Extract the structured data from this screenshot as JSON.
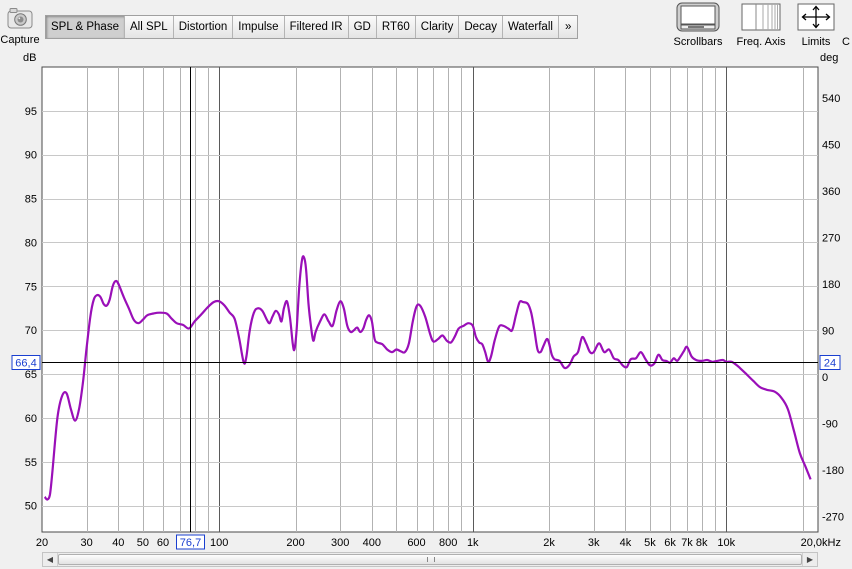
{
  "toolbar": {
    "capture_label": "Capture",
    "tabs": [
      "SPL & Phase",
      "All SPL",
      "Distortion",
      "Impulse",
      "Filtered IR",
      "GD",
      "RT60",
      "Clarity",
      "Decay",
      "Waterfall"
    ],
    "more_label": "»",
    "scrollbars_label": "Scrollbars",
    "freq_axis_label": "Freq. Axis",
    "limits_label": "Limits",
    "cut_label": "C"
  },
  "axes": {
    "left_unit": "dB",
    "right_unit": "deg",
    "x_unit": "kHz"
  },
  "chart_data": {
    "type": "line",
    "x_scale": "log",
    "xlim": [
      20,
      23000
    ],
    "ylim": [
      47,
      100
    ],
    "y2lim": [
      -300,
      600
    ],
    "xticks": [
      {
        "v": 20,
        "label": "20"
      },
      {
        "v": 30,
        "label": "30"
      },
      {
        "v": 40,
        "label": "40"
      },
      {
        "v": 50,
        "label": "50"
      },
      {
        "v": 60,
        "label": "60"
      },
      {
        "v": 100,
        "label": "100"
      },
      {
        "v": 200,
        "label": "200"
      },
      {
        "v": 300,
        "label": "300"
      },
      {
        "v": 400,
        "label": "400"
      },
      {
        "v": 600,
        "label": "600"
      },
      {
        "v": 800,
        "label": "800"
      },
      {
        "v": 1000,
        "label": "1k"
      },
      {
        "v": 2000,
        "label": "2k"
      },
      {
        "v": 3000,
        "label": "3k"
      },
      {
        "v": 4000,
        "label": "4k"
      },
      {
        "v": 5000,
        "label": "5k"
      },
      {
        "v": 6000,
        "label": "6k"
      },
      {
        "v": 7000,
        "label": "7k"
      },
      {
        "v": 8000,
        "label": "8k"
      },
      {
        "v": 10000,
        "label": "10k"
      },
      {
        "v": 20000,
        "label": "20,0kHz"
      }
    ],
    "yticks": [
      50,
      55,
      60,
      65,
      70,
      75,
      80,
      85,
      90,
      95
    ],
    "y2ticks": [
      -270,
      -180,
      -90,
      0,
      90,
      180,
      270,
      360,
      450,
      540
    ],
    "cursor": {
      "x": 76.7,
      "x_label": "76,7",
      "y": 66.4,
      "y_label": "66,4",
      "y2_label": "24"
    },
    "series": [
      {
        "color": "#9a0fb8",
        "points": [
          [
            20.5,
            51
          ],
          [
            21,
            50.7
          ],
          [
            21.5,
            51.3
          ],
          [
            22,
            54
          ],
          [
            23,
            60
          ],
          [
            24,
            62.5
          ],
          [
            25,
            62.8
          ],
          [
            26,
            61
          ],
          [
            27,
            59.7
          ],
          [
            28,
            61
          ],
          [
            29,
            64
          ],
          [
            30,
            68
          ],
          [
            31,
            71.5
          ],
          [
            32,
            73.5
          ],
          [
            33,
            74
          ],
          [
            34,
            73.8
          ],
          [
            35,
            73
          ],
          [
            36,
            72.8
          ],
          [
            37,
            73.5
          ],
          [
            38,
            75
          ],
          [
            39,
            75.6
          ],
          [
            40,
            75.3
          ],
          [
            42,
            73.8
          ],
          [
            44,
            72.5
          ],
          [
            46,
            71.2
          ],
          [
            48,
            70.8
          ],
          [
            50,
            71.2
          ],
          [
            52,
            71.7
          ],
          [
            55,
            71.9
          ],
          [
            58,
            72
          ],
          [
            62,
            71.9
          ],
          [
            65,
            71.3
          ],
          [
            68,
            70.8
          ],
          [
            72,
            70.6
          ],
          [
            76,
            70.2
          ],
          [
            80,
            71
          ],
          [
            85,
            71.8
          ],
          [
            90,
            72.6
          ],
          [
            95,
            73.2
          ],
          [
            100,
            73.3
          ],
          [
            105,
            72.8
          ],
          [
            110,
            72
          ],
          [
            115,
            71.3
          ],
          [
            120,
            69
          ],
          [
            125,
            66.3
          ],
          [
            128,
            67
          ],
          [
            132,
            70
          ],
          [
            137,
            72
          ],
          [
            142,
            72.5
          ],
          [
            148,
            72.2
          ],
          [
            154,
            71.2
          ],
          [
            158,
            70.8
          ],
          [
            162,
            71.5
          ],
          [
            167,
            72.2
          ],
          [
            172,
            71.8
          ],
          [
            176,
            71
          ],
          [
            180,
            72.5
          ],
          [
            185,
            73.3
          ],
          [
            190,
            71.5
          ],
          [
            195,
            68.5
          ],
          [
            198,
            67.8
          ],
          [
            202,
            70
          ],
          [
            207,
            75
          ],
          [
            212,
            78
          ],
          [
            216,
            78.3
          ],
          [
            220,
            77
          ],
          [
            225,
            73
          ],
          [
            230,
            70.5
          ],
          [
            235,
            68.8
          ],
          [
            240,
            69.8
          ],
          [
            250,
            71
          ],
          [
            260,
            71.8
          ],
          [
            270,
            71
          ],
          [
            280,
            70.5
          ],
          [
            290,
            72.2
          ],
          [
            300,
            73.3
          ],
          [
            310,
            72.5
          ],
          [
            320,
            70.5
          ],
          [
            330,
            69.8
          ],
          [
            340,
            70
          ],
          [
            350,
            70.3
          ],
          [
            360,
            69.8
          ],
          [
            370,
            70.2
          ],
          [
            380,
            71.2
          ],
          [
            390,
            71.7
          ],
          [
            400,
            71
          ],
          [
            410,
            69
          ],
          [
            420,
            68.6
          ],
          [
            440,
            68.4
          ],
          [
            460,
            67.8
          ],
          [
            480,
            67.5
          ],
          [
            500,
            67.8
          ],
          [
            520,
            67.6
          ],
          [
            540,
            67.5
          ],
          [
            560,
            68.5
          ],
          [
            580,
            71
          ],
          [
            600,
            72.7
          ],
          [
            620,
            72.8
          ],
          [
            650,
            71.5
          ],
          [
            680,
            69.5
          ],
          [
            700,
            68.7
          ],
          [
            730,
            69
          ],
          [
            760,
            69.4
          ],
          [
            790,
            68.8
          ],
          [
            820,
            68.6
          ],
          [
            850,
            69.3
          ],
          [
            880,
            70.2
          ],
          [
            920,
            70.5
          ],
          [
            960,
            70.8
          ],
          [
            1000,
            70.5
          ],
          [
            1030,
            69.2
          ],
          [
            1060,
            68.6
          ],
          [
            1090,
            68.4
          ],
          [
            1120,
            67.5
          ],
          [
            1150,
            66.4
          ],
          [
            1180,
            67
          ],
          [
            1220,
            68.8
          ],
          [
            1270,
            70.4
          ],
          [
            1320,
            70.5
          ],
          [
            1380,
            70.2
          ],
          [
            1430,
            70
          ],
          [
            1480,
            71.7
          ],
          [
            1530,
            73.2
          ],
          [
            1580,
            73.2
          ],
          [
            1650,
            73
          ],
          [
            1700,
            72
          ],
          [
            1750,
            70
          ],
          [
            1800,
            67.8
          ],
          [
            1850,
            67.5
          ],
          [
            1900,
            68.2
          ],
          [
            1960,
            69
          ],
          [
            2000,
            68.5
          ],
          [
            2050,
            67.2
          ],
          [
            2100,
            66.7
          ],
          [
            2200,
            66.5
          ],
          [
            2300,
            65.7
          ],
          [
            2400,
            66
          ],
          [
            2500,
            67
          ],
          [
            2600,
            67.5
          ],
          [
            2700,
            69.2
          ],
          [
            2800,
            68.5
          ],
          [
            2900,
            67.5
          ],
          [
            3000,
            67.5
          ],
          [
            3150,
            68.5
          ],
          [
            3300,
            67.5
          ],
          [
            3450,
            67.8
          ],
          [
            3600,
            66.8
          ],
          [
            3750,
            66.6
          ],
          [
            3900,
            66
          ],
          [
            4050,
            65.8
          ],
          [
            4200,
            66.7
          ],
          [
            4400,
            66.8
          ],
          [
            4600,
            67.5
          ],
          [
            4800,
            66.7
          ],
          [
            5000,
            66
          ],
          [
            5200,
            66.2
          ],
          [
            5400,
            67.2
          ],
          [
            5600,
            66.6
          ],
          [
            5800,
            66.5
          ],
          [
            6000,
            66.3
          ],
          [
            6200,
            66.8
          ],
          [
            6400,
            66.5
          ],
          [
            6600,
            67
          ],
          [
            6800,
            67.6
          ],
          [
            7000,
            68.1
          ],
          [
            7300,
            67
          ],
          [
            7600,
            66.6
          ],
          [
            8000,
            66.5
          ],
          [
            8400,
            66.6
          ],
          [
            8800,
            66.4
          ],
          [
            9200,
            66.5
          ],
          [
            9700,
            66.6
          ],
          [
            10000,
            66.4
          ],
          [
            10500,
            66.4
          ],
          [
            11000,
            66
          ],
          [
            11500,
            65.5
          ],
          [
            12000,
            65
          ],
          [
            12800,
            64.2
          ],
          [
            13600,
            63.5
          ],
          [
            14500,
            63.2
          ],
          [
            15500,
            63
          ],
          [
            16500,
            62.3
          ],
          [
            17500,
            61
          ],
          [
            18500,
            58.5
          ],
          [
            19500,
            56
          ],
          [
            20500,
            54.5
          ],
          [
            21500,
            53
          ]
        ]
      }
    ]
  }
}
